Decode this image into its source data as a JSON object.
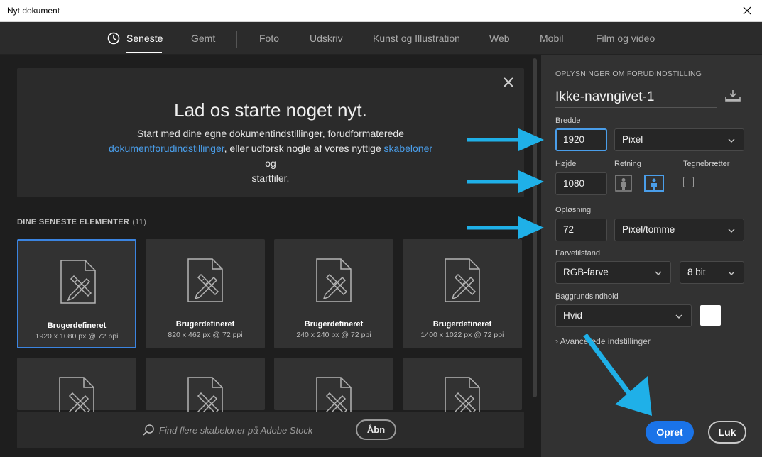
{
  "window": {
    "title": "Nyt dokument",
    "close_icon": "close-icon"
  },
  "tabs": [
    {
      "label": "Seneste",
      "active": true
    },
    {
      "label": "Gemt"
    },
    {
      "label": "Foto"
    },
    {
      "label": "Udskriv"
    },
    {
      "label": "Kunst og Illustration"
    },
    {
      "label": "Web"
    },
    {
      "label": "Mobil"
    },
    {
      "label": "Film og video"
    }
  ],
  "hero": {
    "heading": "Lad os starte noget nyt.",
    "text_1": "Start med dine egne dokumentindstillinger, forudformaterede",
    "link_1": "dokumentforudindstillinger",
    "text_2": ", eller udforsk nogle af vores nyttige ",
    "link_2": "skabeloner",
    "text_3": " og",
    "text_4": "startfiler."
  },
  "recent": {
    "title": "DINE SENESTE ELEMENTER",
    "count": "(11)",
    "items": [
      {
        "name": "Brugerdefineret",
        "size": "1920 x 1080 px @ 72 ppi"
      },
      {
        "name": "Brugerdefineret",
        "size": "820 x 462 px @ 72 ppi"
      },
      {
        "name": "Brugerdefineret",
        "size": "240 x 240 px @ 72 ppi"
      },
      {
        "name": "Brugerdefineret",
        "size": "1400 x 1022 px @ 72 ppi"
      }
    ]
  },
  "stock": {
    "placeholder": "Find flere skabeloner på Adobe Stock",
    "button": "Åbn"
  },
  "preset": {
    "heading": "OPLYSNINGER OM FORUDINDSTILLING",
    "doc_name": "Ikke-navngivet-1",
    "width_label": "Bredde",
    "width_value": "1920",
    "width_unit": "Pixel",
    "height_label": "Højde",
    "height_value": "1080",
    "orientation_label": "Retning",
    "artboards_label": "Tegnebrætter",
    "resolution_label": "Opløsning",
    "resolution_value": "72",
    "resolution_unit": "Pixel/tomme",
    "color_mode_label": "Farvetilstand",
    "color_mode_value": "RGB-farve",
    "bit_depth_value": "8 bit",
    "background_label": "Baggrundsindhold",
    "background_value": "Hvid",
    "background_color": "#ffffff",
    "advanced_label": "Avancerede indstillinger"
  },
  "actions": {
    "create": "Opret",
    "close": "Luk"
  },
  "colors": {
    "accent": "#1a73e8",
    "link": "#4a9eea",
    "annotation_arrow": "#1fb0e8"
  }
}
